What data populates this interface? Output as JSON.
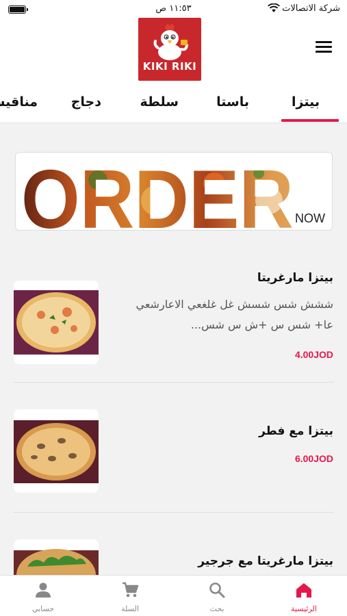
{
  "status_bar": {
    "carrier": "شركة الاتصالات",
    "time": "١١:٥٣ ص",
    "wifi_icon": "wifi-icon",
    "battery_icon": "battery-icon"
  },
  "header": {
    "logo_text": "KIKI RIKI",
    "menu_icon": "hamburger-menu-icon"
  },
  "tabs": [
    {
      "label": "بيتزا",
      "active": true
    },
    {
      "label": "باستا",
      "active": false
    },
    {
      "label": "سلطة",
      "active": false
    },
    {
      "label": "دجاج",
      "active": false
    },
    {
      "label": "مناقيش",
      "active": false
    }
  ],
  "banner": {
    "word": "ORDER",
    "now": "NOW"
  },
  "items": [
    {
      "name": "بيتزا مارغريتا",
      "description": "ششش شس شسش غل غلغعي الاعارشعي عا+ شس س +ش س شس...",
      "price": "4.00JOD"
    },
    {
      "name": "بيتزا مع فطر",
      "description": "",
      "price": "6.00JOD"
    },
    {
      "name": "بيتزا مارغريتا مع جرجير",
      "description": "",
      "price": ""
    }
  ],
  "bottom_nav": [
    {
      "label": "الرئيسية",
      "icon": "home-icon",
      "active": true
    },
    {
      "label": "بحث",
      "icon": "search-icon",
      "active": false
    },
    {
      "label": "السلة",
      "icon": "cart-icon",
      "active": false
    },
    {
      "label": "حسابي",
      "icon": "user-icon",
      "active": false
    }
  ],
  "colors": {
    "accent": "#e5174b",
    "logo_bg": "#c8282c"
  }
}
